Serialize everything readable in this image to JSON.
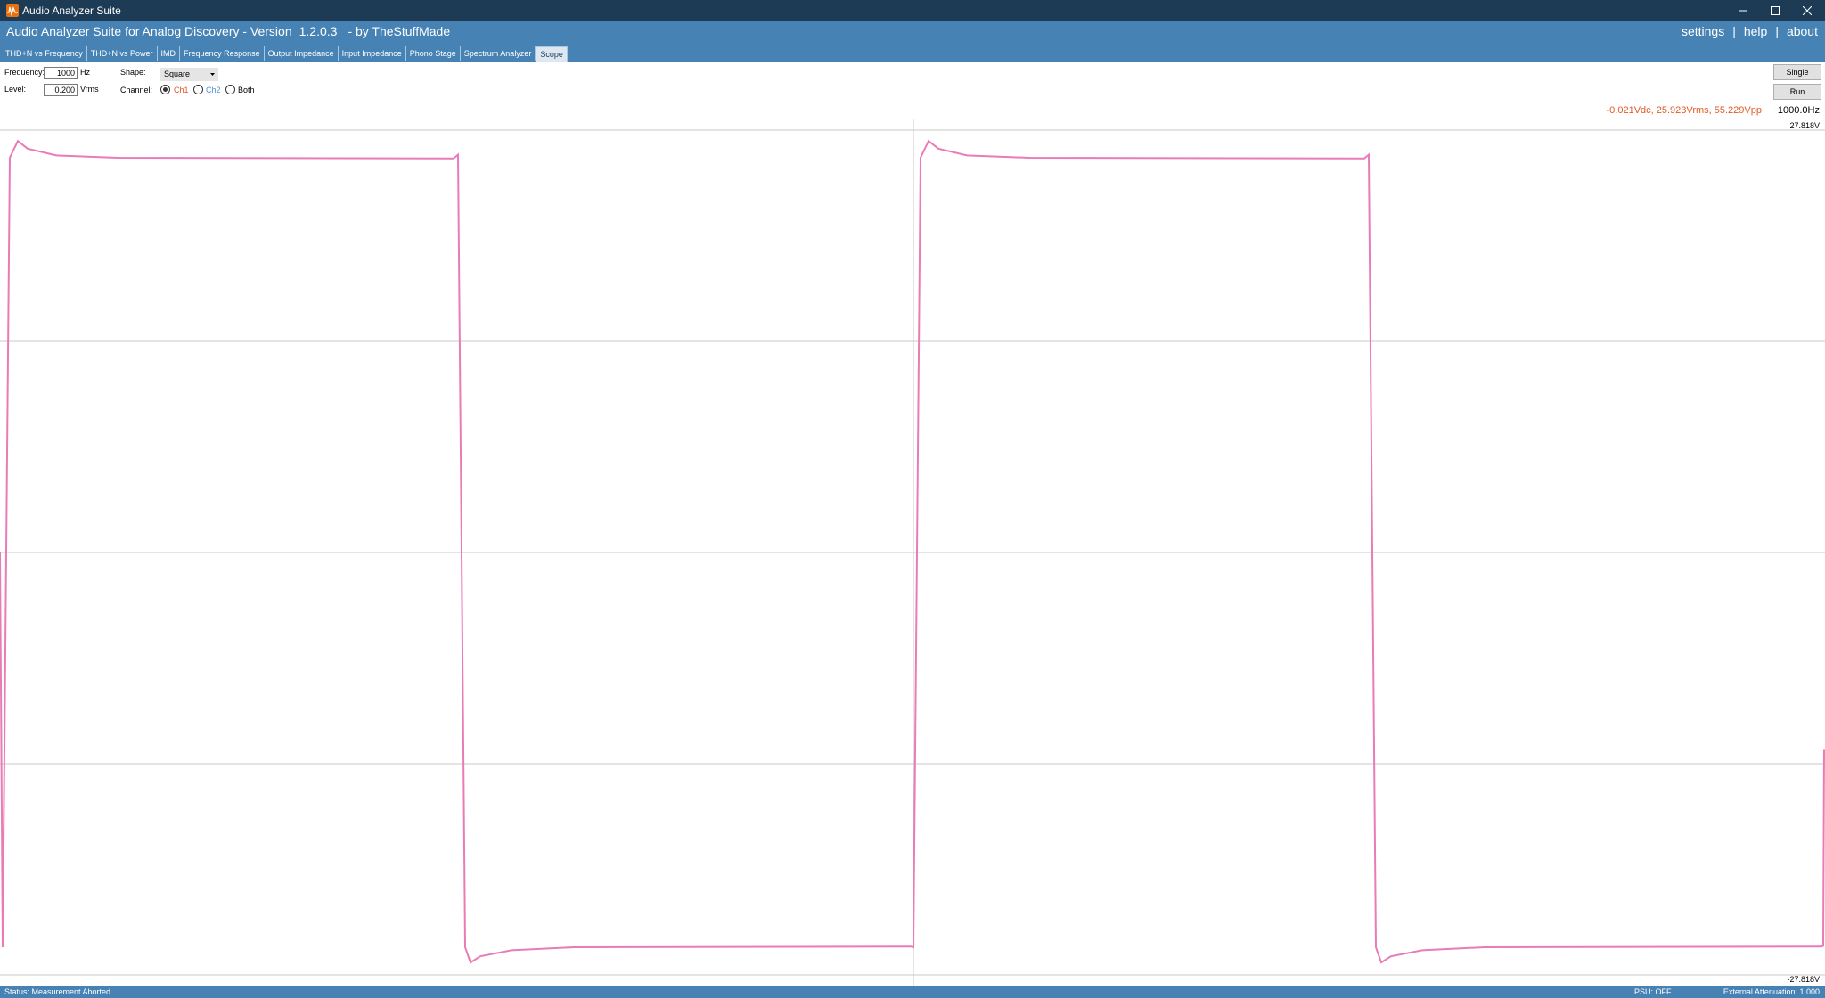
{
  "window": {
    "title": "Audio Analyzer Suite"
  },
  "header": {
    "app_title": "Audio Analyzer Suite for Analog Discovery - Version",
    "version": "1.2.0.3",
    "author": "- by TheStuffMade",
    "links": {
      "settings": "settings",
      "help": "help",
      "about": "about"
    },
    "separator": "|"
  },
  "tabs": [
    {
      "label": "THD+N vs Frequency"
    },
    {
      "label": "THD+N vs Power"
    },
    {
      "label": "IMD"
    },
    {
      "label": "Frequency Response"
    },
    {
      "label": "Output Impedance"
    },
    {
      "label": "Input Impedance"
    },
    {
      "label": "Phono Stage"
    },
    {
      "label": "Spectrum Analyzer"
    },
    {
      "label": "Scope"
    }
  ],
  "active_tab": "Scope",
  "controls": {
    "frequency": {
      "label": "Frequency:",
      "value": "1000",
      "unit": "Hz"
    },
    "level": {
      "label": "Level:",
      "value": "0.200",
      "unit": "Vrms"
    },
    "shape": {
      "label": "Shape:",
      "value": "Square"
    },
    "channel": {
      "label": "Channel:",
      "options": [
        {
          "label": "Ch1",
          "selected": true,
          "color": "#e05a24"
        },
        {
          "label": "Ch2",
          "selected": false,
          "color": "#4a90d9"
        },
        {
          "label": "Both",
          "selected": false,
          "color": "#000000"
        }
      ]
    },
    "buttons": {
      "single": "Single",
      "run": "Run"
    }
  },
  "readout": {
    "measurements": "-0.021Vdc, 25.923Vrms, 55.229Vpp",
    "frequency": "1000.0Hz"
  },
  "chart_data": {
    "type": "line",
    "y_top_label": "27.818V",
    "y_bottom_label": "-27.818V",
    "ylim": [
      -27.818,
      27.818
    ],
    "grid": true,
    "series": [
      {
        "color": "#e97cb6",
        "waveform": "square",
        "high_level": 26.0,
        "low_level": -26.0,
        "overshoot_peak": 27.1,
        "undershoot_peak": -27.0
      }
    ]
  },
  "status": {
    "text": "Status: Measurement Aborted",
    "psu": "PSU: OFF",
    "attenuation": "External Attenuation: 1.000"
  },
  "colors": {
    "titlebar": "#1e3b55",
    "header": "#4782b4",
    "trace": "#e97cb6",
    "readout": "#e05a24"
  }
}
